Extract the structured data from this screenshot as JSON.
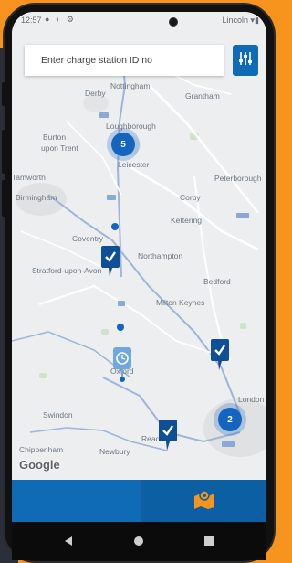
{
  "status": {
    "time": "12:57",
    "carrier": "Lincoln"
  },
  "search": {
    "placeholder": "Enter charge station ID no"
  },
  "map": {
    "attribution": "Google",
    "towns": {
      "derby": "Derby",
      "nottingham": "Nottingham",
      "grantham": "Grantham",
      "loughborough": "Loughborough",
      "burton": "Burton",
      "upon_trent": "upon Trent",
      "leicester": "Leicester",
      "peterborough": "Peterborough",
      "tamworth": "Tamworth",
      "birmingham": "Birmingham",
      "coventry": "Coventry",
      "corby": "Corby",
      "kettering": "Kettering",
      "northampton": "Northampton",
      "stratford": "Stratford-upon-Avon",
      "bedford": "Bedford",
      "milton_keynes": "Milton Keynes",
      "oxford": "Oxford",
      "swindon": "Swindon",
      "chippenham": "Chippenham",
      "newbury": "Newbury",
      "reading": "Reading",
      "london": "London"
    },
    "clusters": [
      {
        "count": "5"
      },
      {
        "count": "2"
      }
    ]
  },
  "colors": {
    "primary": "#0f6bb5",
    "accent": "#f7941d",
    "cluster": "#1565c0"
  },
  "icons": {
    "filter": "sliders-icon",
    "map_tab": "map-icon",
    "marker": "charger-check-marker-icon",
    "back": "back-triangle-icon",
    "home": "home-circle-icon",
    "recents": "recents-square-icon"
  }
}
